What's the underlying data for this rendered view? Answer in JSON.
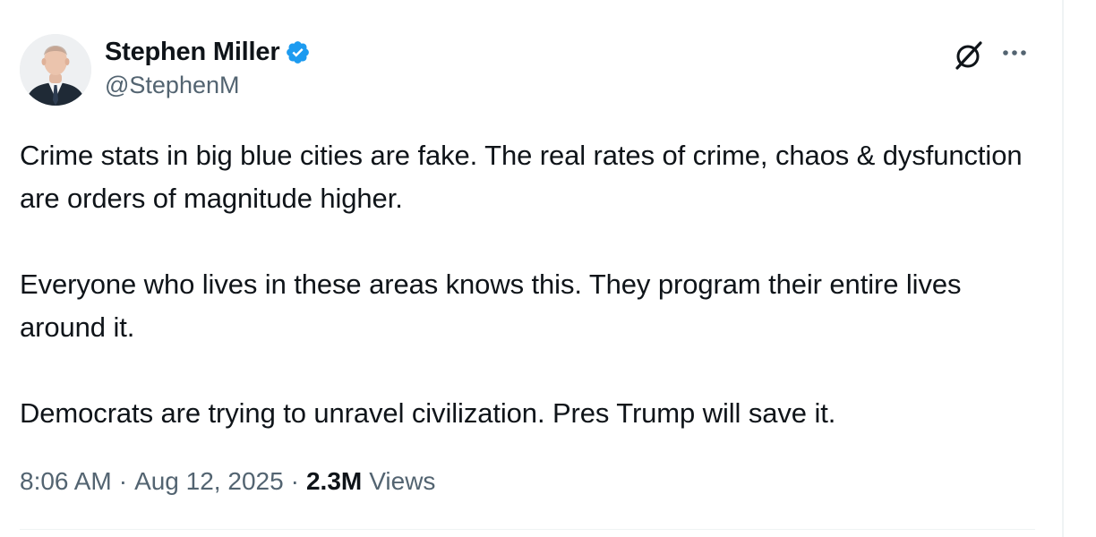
{
  "author": {
    "display_name": "Stephen Miller",
    "handle": "@StephenM",
    "verified": true
  },
  "tweet": {
    "paragraphs": [
      "Crime stats in big blue cities are fake. The real rates of crime, chaos & dysfunction are orders of magnitude higher.",
      "Everyone who lives in these areas knows this. They program their entire lives around it.",
      "Democrats are trying to unravel civilization. Pres Trump will save it."
    ],
    "time": "8:06 AM",
    "date": "Aug 12, 2025",
    "separator": "·",
    "views_count": "2.3M",
    "views_label": "Views"
  },
  "icons": {
    "verified": "verified-badge-icon",
    "grok": "grok-icon",
    "more": "more-options-icon"
  },
  "colors": {
    "text_primary": "#0f1419",
    "text_secondary": "#536471",
    "verified_blue": "#1d9bf0",
    "divider": "#eff3f4"
  }
}
